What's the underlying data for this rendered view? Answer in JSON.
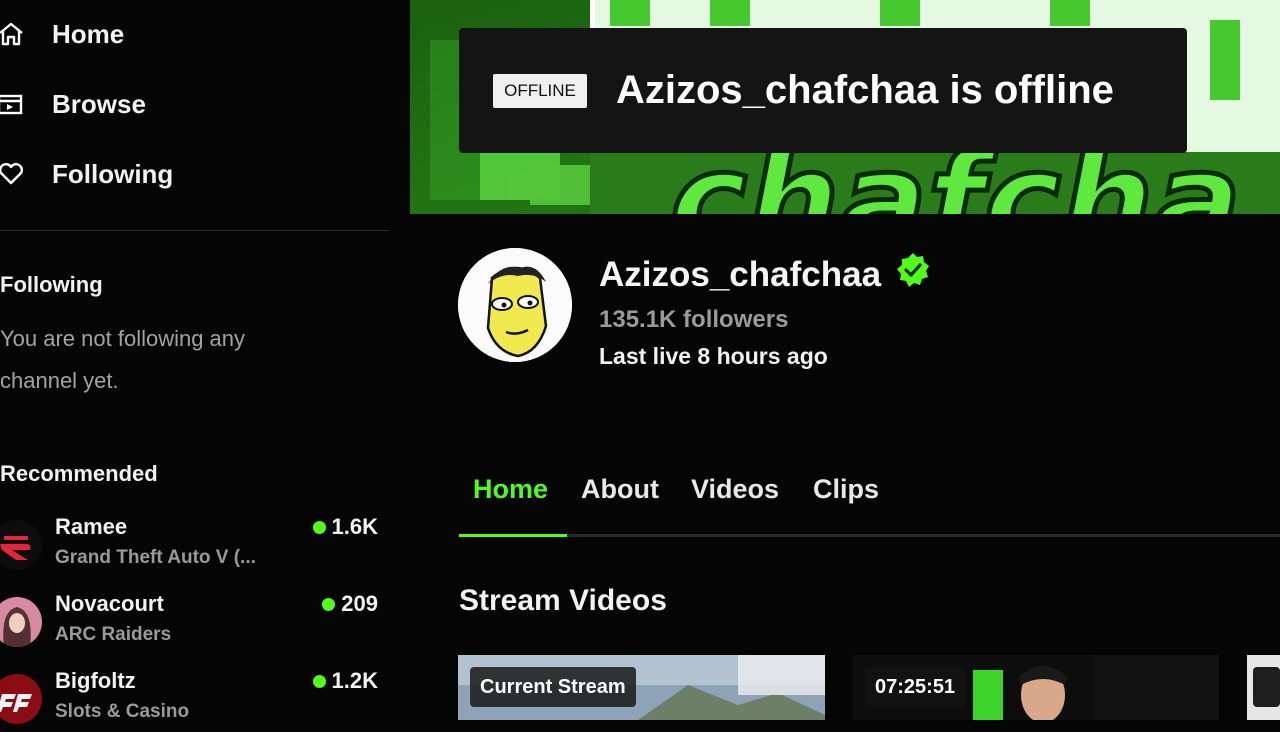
{
  "sidebar": {
    "nav": [
      {
        "label": "Home",
        "icon": "home-icon"
      },
      {
        "label": "Browse",
        "icon": "browse-icon"
      },
      {
        "label": "Following",
        "icon": "heart-icon"
      }
    ],
    "following": {
      "title": "Following",
      "empty_text": "You are not following any channel yet."
    },
    "recommended": {
      "title": "Recommended",
      "items": [
        {
          "name": "Ramee",
          "category": "Grand Theft Auto V (...",
          "viewers": "1.6K"
        },
        {
          "name": "Novacourt",
          "category": "ARC Raiders",
          "viewers": "209"
        },
        {
          "name": "Bigfoltz",
          "category": "Slots & Casino",
          "viewers": "1.2K"
        }
      ]
    }
  },
  "banner": {
    "offline_badge": "OFFLINE",
    "offline_message": "Azizos_chafchaa is offline"
  },
  "channel": {
    "name": "Azizos_chafchaa",
    "verified": true,
    "followers": "135.1K followers",
    "last_live": "Last live 8 hours ago"
  },
  "tabs": [
    {
      "label": "Home",
      "active": true
    },
    {
      "label": "About",
      "active": false
    },
    {
      "label": "Videos",
      "active": false
    },
    {
      "label": "Clips",
      "active": false
    }
  ],
  "stream_videos": {
    "title": "Stream Videos",
    "cards": [
      {
        "label": "Current Stream"
      },
      {
        "label": "07:25:51"
      },
      {
        "label": ""
      }
    ]
  },
  "colors": {
    "accent": "#53fc18",
    "background": "#050505",
    "muted_text": "#9a9a9a"
  }
}
